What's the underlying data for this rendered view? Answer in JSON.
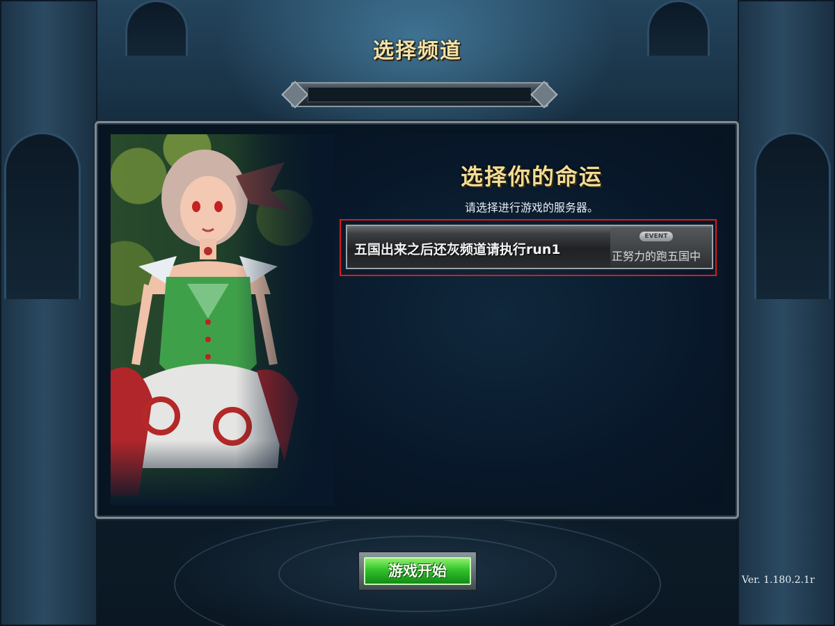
{
  "screen_title": "选择频道",
  "panel": {
    "heading": "选择你的命运",
    "hint": "请选择进行游戏的服务器。"
  },
  "channels": [
    {
      "name": "五国出来之后还灰频道请执行run1",
      "badge": "EVENT",
      "status": "正努力的跑五国中",
      "selected": true
    }
  ],
  "start_button": {
    "label": "游戏开始"
  },
  "version": "Ver. 1.180.2.1r",
  "colors": {
    "title_gold": "#f3e1a6",
    "selection_outline": "#e01818",
    "start_green": "#33c22c",
    "panel_bg": "#071523"
  }
}
